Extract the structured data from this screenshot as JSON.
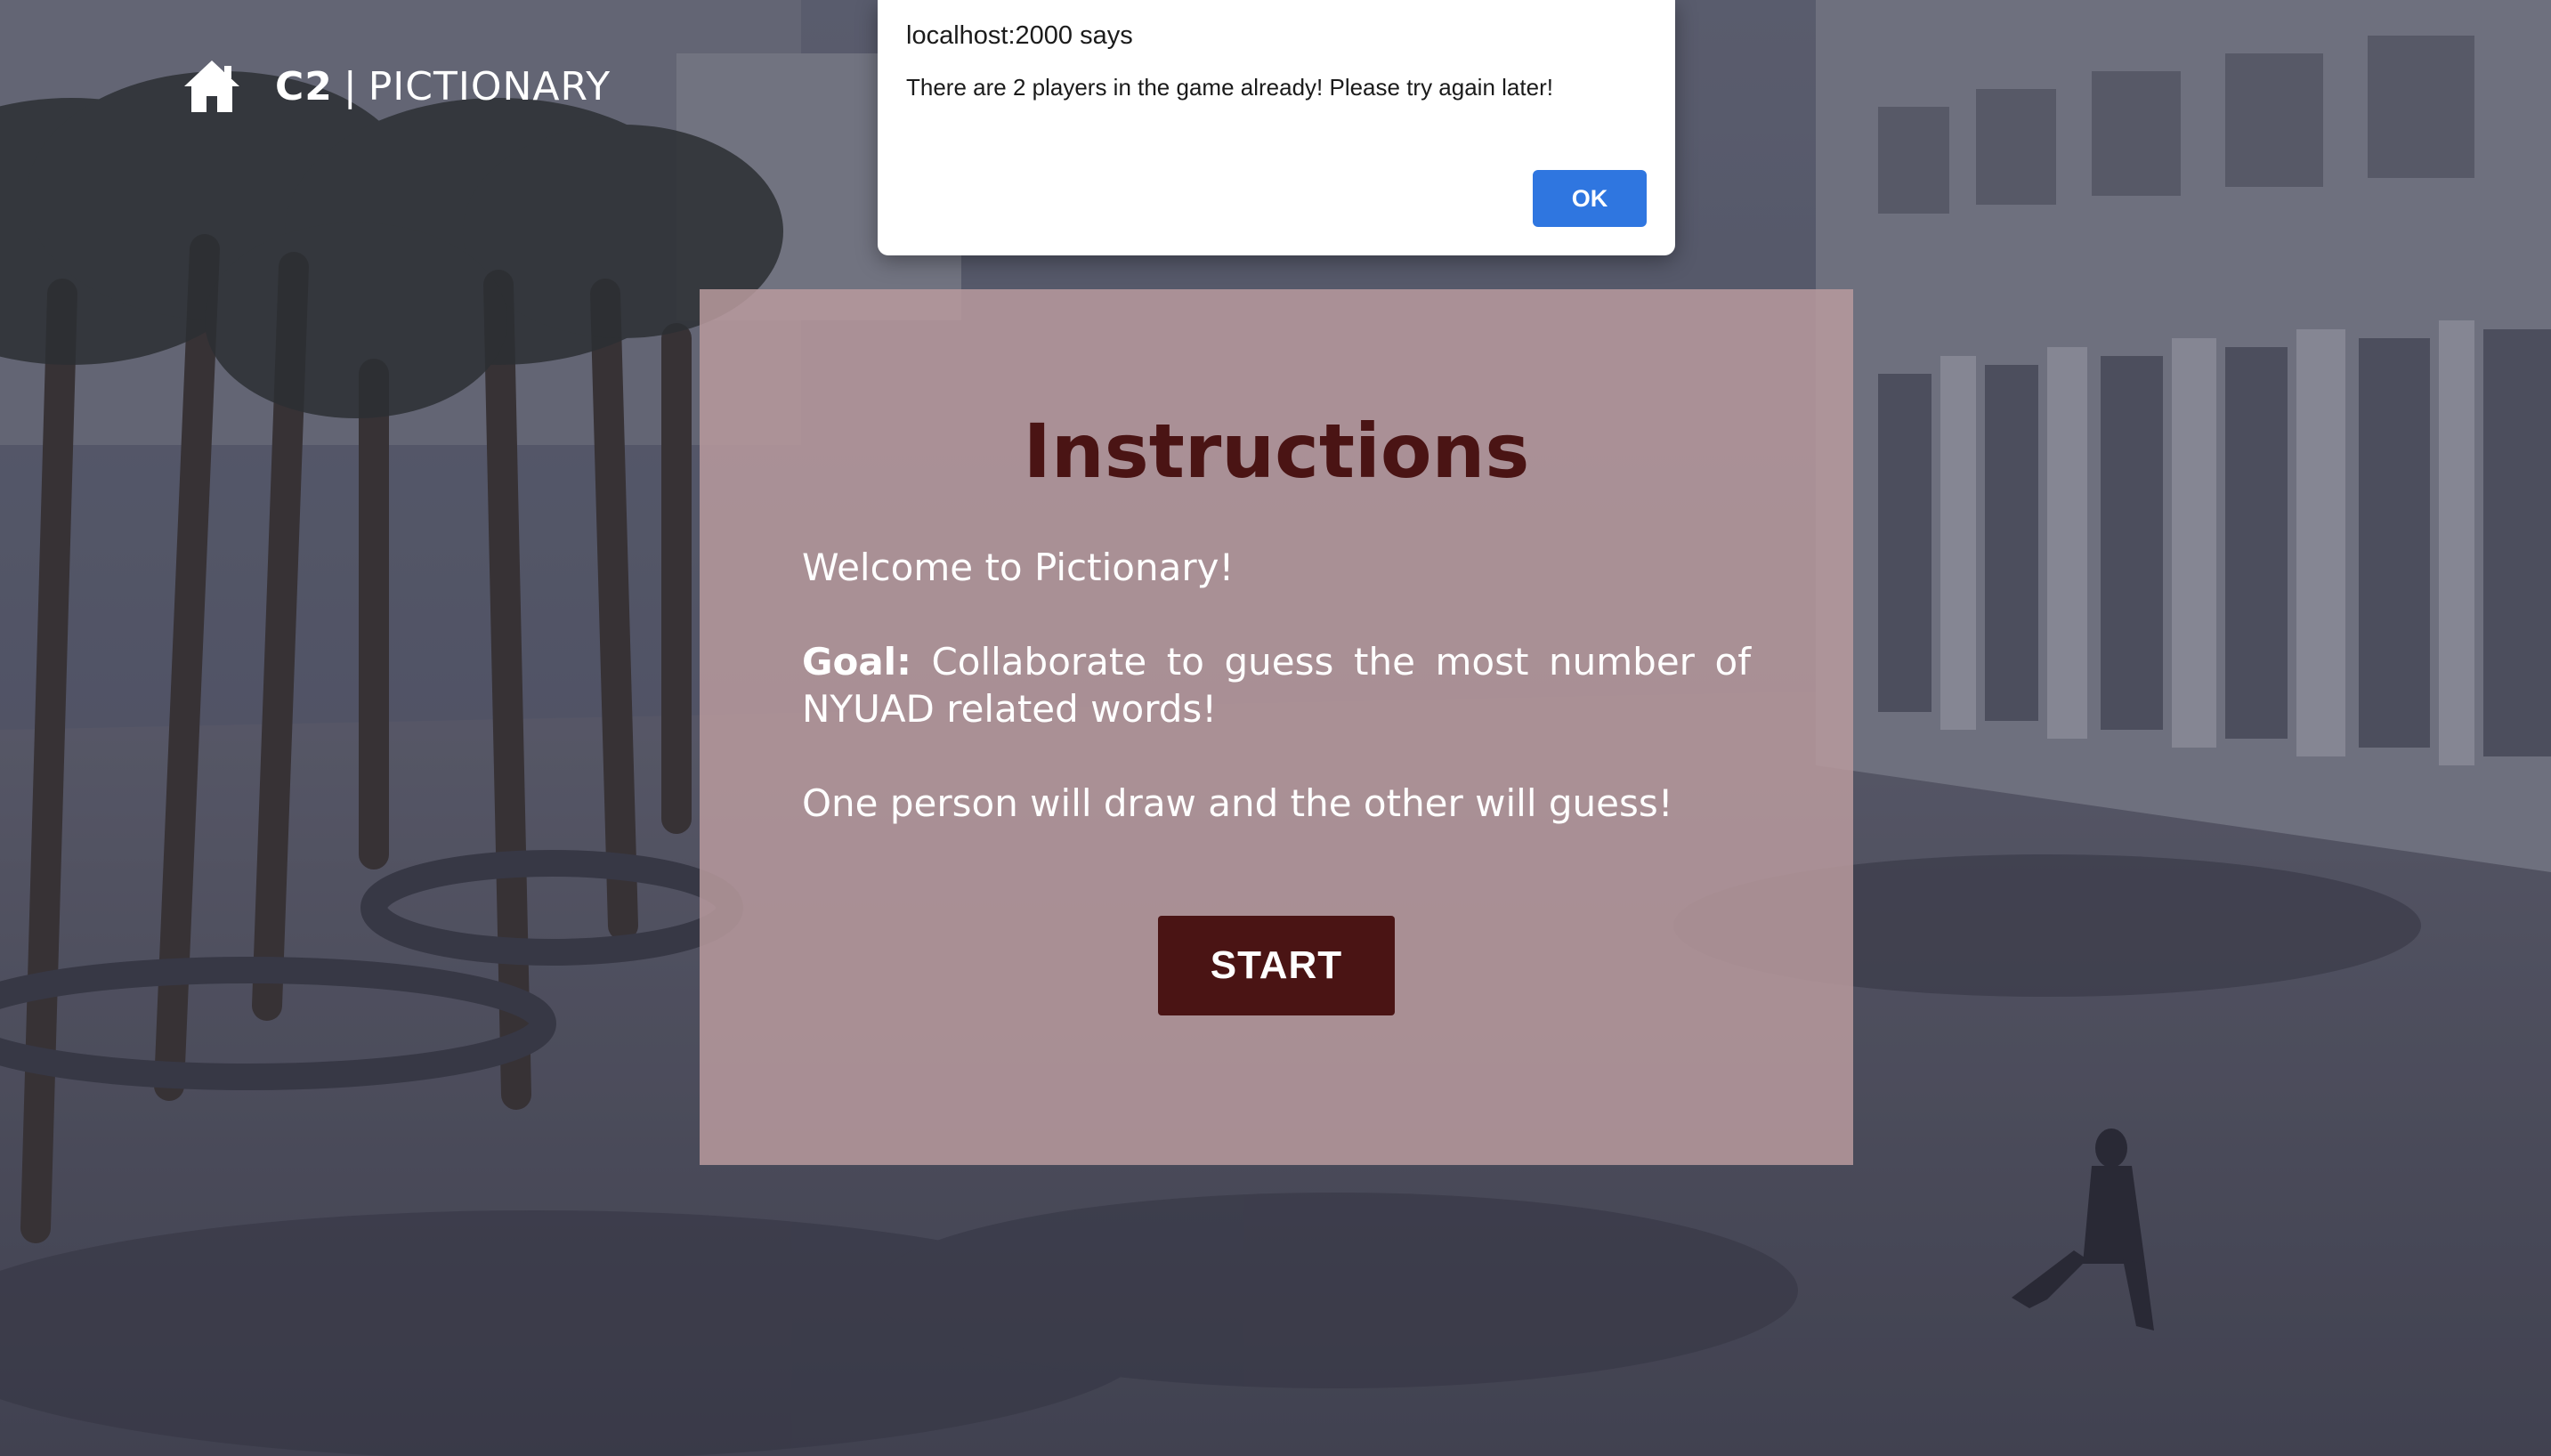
{
  "header": {
    "home_icon": "home-icon",
    "brand_strong": "C2",
    "brand_separator": "|",
    "brand_name": "PICTIONARY"
  },
  "card": {
    "title": "Instructions",
    "welcome": "Welcome to Pictionary!",
    "goal_label": "Goal:",
    "goal_text": " Collaborate to guess the most number of NYUAD related words!",
    "roles": "One person will draw and the other will guess!",
    "start_label": "START"
  },
  "dialog": {
    "title": "localhost:2000 says",
    "message": "There are 2 players in the game already! Please try again later!",
    "ok_label": "OK"
  },
  "colors": {
    "accent_dark": "#4a1414",
    "card_background": "#b89a9d",
    "dialog_button": "#2f76e0"
  }
}
